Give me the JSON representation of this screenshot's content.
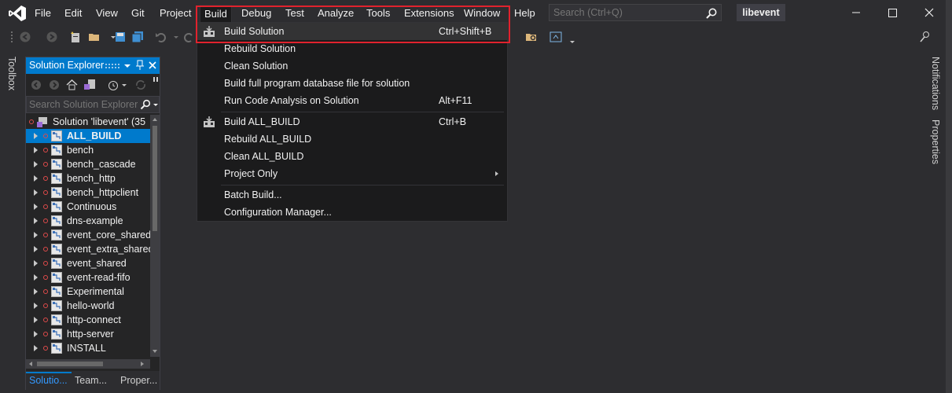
{
  "menubar": {
    "items": [
      "File",
      "Edit",
      "View",
      "Git",
      "Project",
      "Build",
      "Debug",
      "Test",
      "Analyze",
      "Tools",
      "Extensions",
      "Window",
      "Help"
    ],
    "search_placeholder": "Search (Ctrl+Q)",
    "project_name": "libevent"
  },
  "build_menu": {
    "items": [
      {
        "label": "Build Solution",
        "shortcut": "Ctrl+Shift+B",
        "icon": "build-icon",
        "hover": true
      },
      {
        "label": "Rebuild Solution",
        "shortcut": ""
      },
      {
        "label": "Clean Solution",
        "shortcut": ""
      },
      {
        "label": "Build full program database file for solution",
        "shortcut": ""
      },
      {
        "label": "Run Code Analysis on Solution",
        "shortcut": "Alt+F11"
      },
      {
        "label": "Build ALL_BUILD",
        "shortcut": "Ctrl+B",
        "icon": "build-icon"
      },
      {
        "label": "Rebuild ALL_BUILD",
        "shortcut": ""
      },
      {
        "label": "Clean ALL_BUILD",
        "shortcut": ""
      },
      {
        "label": "Project Only",
        "shortcut": "",
        "submenu": true
      },
      {
        "label": "Batch Build...",
        "shortcut": ""
      },
      {
        "label": "Configuration Manager...",
        "shortcut": ""
      }
    ]
  },
  "solution_explorer": {
    "title": "Solution Explorer",
    "search_placeholder": "Search Solution Explorer",
    "root": "Solution 'libevent' (35",
    "items": [
      "ALL_BUILD",
      "bench",
      "bench_cascade",
      "bench_http",
      "bench_httpclient",
      "Continuous",
      "dns-example",
      "event_core_shared",
      "event_extra_shared",
      "event_shared",
      "event-read-fifo",
      "Experimental",
      "hello-world",
      "http-connect",
      "http-server",
      "INSTALL"
    ],
    "selected": "ALL_BUILD",
    "bottom_tabs": [
      "Solutio...",
      "Team...",
      "Proper..."
    ]
  },
  "side_tabs": {
    "left": "Toolbox",
    "right": [
      "Notifications",
      "Properties"
    ]
  },
  "colors": {
    "accent": "#007acc",
    "highlight_box": "#e1222d",
    "background": "#2d2d30"
  }
}
